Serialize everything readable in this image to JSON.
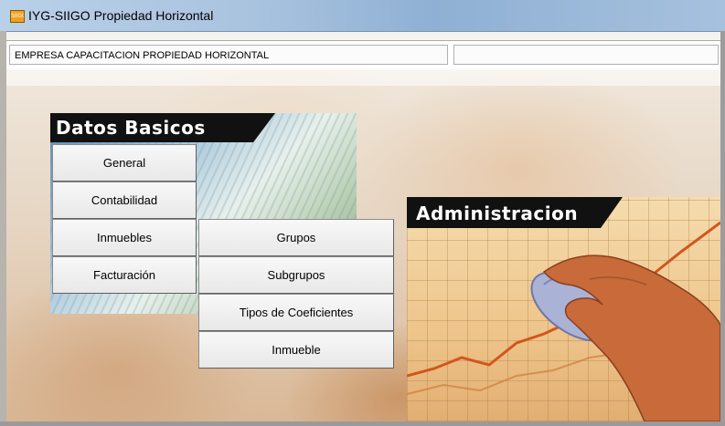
{
  "window": {
    "title": "IYG-SIIGO Propiedad Horizontal",
    "icon_label": "SIIGO"
  },
  "status": {
    "company": "EMPRESA CAPACITACION PROPIEDAD HORIZONTAL",
    "second": ""
  },
  "datos_basicos": {
    "title": "Datos Basicos",
    "buttons": [
      "General",
      "Contabilidad",
      "Inmuebles",
      "Facturación"
    ]
  },
  "inmuebles_submenu": {
    "items": [
      "Grupos",
      "Subgrupos",
      "Tipos de Coeficientes",
      "Inmueble"
    ]
  },
  "administracion": {
    "title": "Administracion"
  },
  "colors": {
    "title_bar": "#a9c3df",
    "panel_header": "#111111",
    "chart_line": "#d2561e",
    "hand": "#c86a3a",
    "mouse": "#aab2d6"
  },
  "icons": [
    "siigo-app-icon",
    "computer-mouse-icon",
    "hand-icon"
  ]
}
